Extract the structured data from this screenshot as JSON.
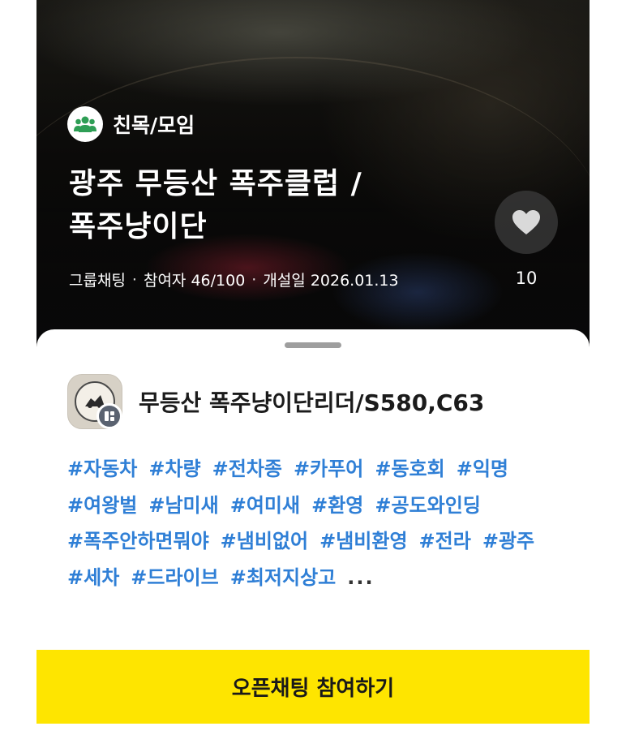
{
  "hero": {
    "category_icon": "group-people-icon",
    "category": "친목/모임",
    "title_line1": "광주 무등산 폭주클럽 /",
    "title_line2": "폭주냥이단",
    "chat_type": "그룹채팅",
    "members": "참여자 46/100",
    "created": "개설일 2026.01.13",
    "like_icon": "heart-icon",
    "like_count": "10"
  },
  "owner": {
    "avatar_icon": "profile-avatar",
    "host_badge_icon": "host-badge-icon",
    "name": "무등산 폭주냥이단리더/S580,C63"
  },
  "tags": [
    "#자동차",
    "#차량",
    "#전차종",
    "#카푸어",
    "#동호회",
    "#익명",
    "#여왕벌",
    "#남미새",
    "#여미새",
    "#환영",
    "#공도와인딩",
    "#폭주안하면뭐야",
    "#냄비없어",
    "#냄비환영",
    "#전라",
    "#광주",
    "#세차",
    "#드라이브",
    "#최저지상고"
  ],
  "tags_more": "...",
  "join_button": "오픈채팅 참여하기",
  "colors": {
    "tag": "#2f7fd6",
    "join_button_bg": "#fee500",
    "category_icon": "#2e9e55"
  }
}
